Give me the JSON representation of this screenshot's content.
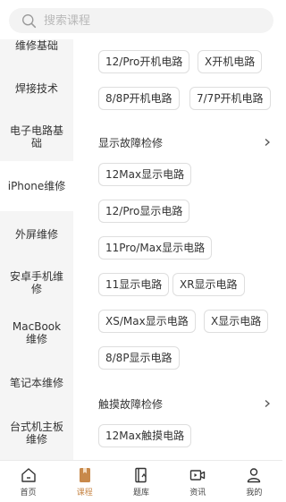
{
  "search": {
    "placeholder": "搜索课程"
  },
  "sidebar": {
    "items": [
      {
        "label": "维修基础"
      },
      {
        "label": "焊接技术"
      },
      {
        "label": "电子电路基础"
      },
      {
        "label": "iPhone维修"
      },
      {
        "label": "外屏维修"
      },
      {
        "label": "安卓手机维修"
      },
      {
        "label": "MacBook维修"
      },
      {
        "label": "笔记本维修"
      },
      {
        "label": "台式机主板维修"
      }
    ]
  },
  "content": {
    "top_tags": [
      "12/Pro开机电路",
      "X开机电路",
      "8/8P开机电路",
      "7/7P开机电路"
    ],
    "sections": [
      {
        "title": "显示故障检修",
        "tags": [
          "12Max显示电路",
          "12/Pro显示电路",
          "11Pro/Max显示电路",
          "11显示电路",
          "XR显示电路",
          "XS/Max显示电路",
          "X显示电路",
          "8/8P显示电路"
        ]
      },
      {
        "title": "触摸故障检修",
        "tags": [
          "12Max触摸电路"
        ]
      }
    ]
  },
  "tabbar": {
    "active_color": "#c8894b",
    "items": [
      {
        "label": "首页",
        "icon": "home-icon"
      },
      {
        "label": "课程",
        "icon": "course-book-icon"
      },
      {
        "label": "题库",
        "icon": "question-bank-icon"
      },
      {
        "label": "资讯",
        "icon": "video-news-icon"
      },
      {
        "label": "我的",
        "icon": "profile-icon"
      }
    ]
  }
}
